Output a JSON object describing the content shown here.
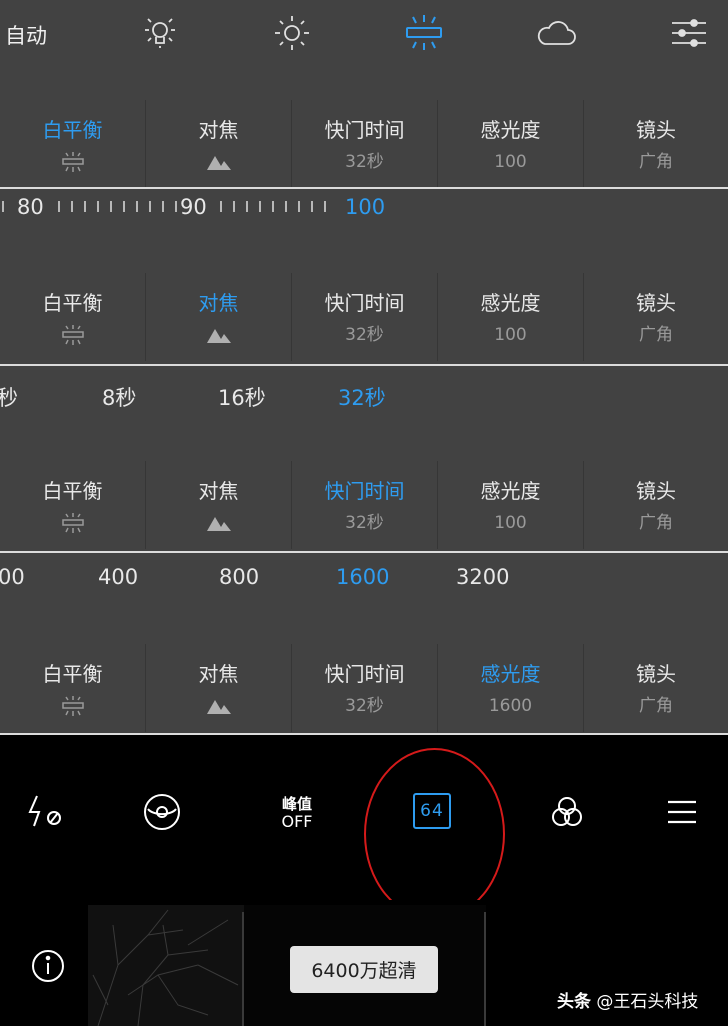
{
  "white_balance": {
    "auto_label": "自动",
    "icons": [
      "incandescent-icon",
      "sunny-icon",
      "fluorescent-icon",
      "cloudy-icon",
      "adjust-sliders-icon"
    ],
    "active_icon": "fluorescent-icon"
  },
  "param_rows": [
    {
      "active": 0,
      "cells": [
        {
          "label": "白平衡",
          "sub_icon": "fluorescent-icon"
        },
        {
          "label": "对焦",
          "sub_icon": "mountain-icon"
        },
        {
          "label": "快门时间",
          "sub": "32秒"
        },
        {
          "label": "感光度",
          "sub": "100"
        },
        {
          "label": "镜头",
          "sub": "广角"
        }
      ]
    },
    {
      "active": 1,
      "cells": [
        {
          "label": "白平衡",
          "sub_icon": "fluorescent-icon"
        },
        {
          "label": "对焦",
          "sub_icon": "mountain-icon"
        },
        {
          "label": "快门时间",
          "sub": "32秒"
        },
        {
          "label": "感光度",
          "sub": "100"
        },
        {
          "label": "镜头",
          "sub": "广角"
        }
      ]
    },
    {
      "active": 2,
      "cells": [
        {
          "label": "白平衡",
          "sub_icon": "fluorescent-icon"
        },
        {
          "label": "对焦",
          "sub_icon": "mountain-icon"
        },
        {
          "label": "快门时间",
          "sub": "32秒"
        },
        {
          "label": "感光度",
          "sub": "100"
        },
        {
          "label": "镜头",
          "sub": "广角"
        }
      ]
    },
    {
      "active": 3,
      "cells": [
        {
          "label": "白平衡",
          "sub_icon": "fluorescent-icon"
        },
        {
          "label": "对焦",
          "sub_icon": "mountain-icon"
        },
        {
          "label": "快门时间",
          "sub": "32秒"
        },
        {
          "label": "感光度",
          "sub": "1600"
        },
        {
          "label": "镜头",
          "sub": "广角"
        }
      ]
    }
  ],
  "focus_scale": {
    "values": [
      "80",
      "90",
      "100"
    ],
    "active": "100"
  },
  "shutter_strip": {
    "values": [
      "秒",
      "8秒",
      "16秒",
      "32秒"
    ],
    "active": "32秒"
  },
  "iso_strip": {
    "values": [
      "00",
      "400",
      "800",
      "1600",
      "3200"
    ],
    "active": "1600"
  },
  "toolbar": {
    "flash_icon": "flash-off-icon",
    "lens_icon": "lens-icon",
    "peak_title": "峰值",
    "peak_state": "OFF",
    "resolution_label": "64",
    "filter_icon": "filter-icon",
    "menu_icon": "menu-icon",
    "highlight_color": "#d51a1a",
    "accent_color": "#2e9cf0"
  },
  "bottom": {
    "info_icon": "info-icon",
    "mode_badge": "6400万超清",
    "watermark_prefix": "头条",
    "watermark_user": "@王石头科技"
  }
}
